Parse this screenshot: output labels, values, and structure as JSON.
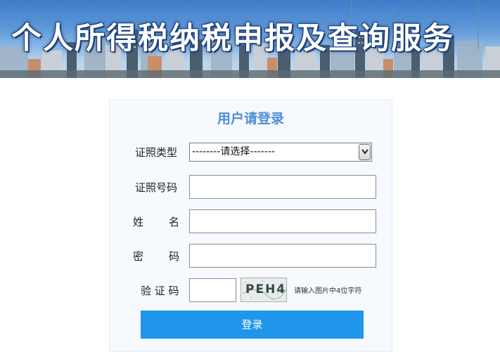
{
  "banner": {
    "title": "个人所得税纳税申报及查询服务"
  },
  "login": {
    "title": "用户请登录",
    "id_type": {
      "label": "证照类型",
      "selected": "--------请选择-------"
    },
    "id_number": {
      "label": "证照号码",
      "value": ""
    },
    "name": {
      "label_1": "姓",
      "label_2": "名",
      "value": ""
    },
    "password": {
      "label_1": "密",
      "label_2": "码",
      "value": ""
    },
    "captcha": {
      "label": "验 证 码",
      "value": "",
      "image_text": "PEH4",
      "hint": "请输入图片中4位字符"
    },
    "submit_label": "登录"
  },
  "colors": {
    "title_blue": "#4d8fd6",
    "button_blue": "#1f96ea",
    "panel_bg": "#f6f9fd"
  },
  "icons": {
    "select_arrow": "chevron-down-icon"
  }
}
